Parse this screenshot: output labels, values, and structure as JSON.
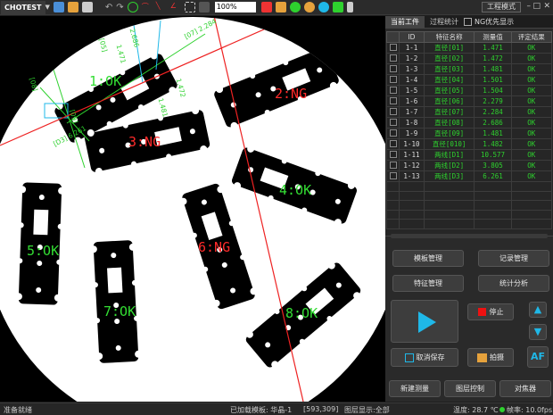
{
  "app": {
    "title": "CHOTEST",
    "mode_button": "工程模式",
    "zoom": "100%"
  },
  "tabs": {
    "current": "当前工件",
    "stats": "过程统计",
    "ng_first": "NG优先显示"
  },
  "table": {
    "headers": [
      "",
      "ID",
      "特征名称",
      "测量值",
      "评定结果"
    ],
    "rows": [
      {
        "id": "1-1",
        "name": "直径[01]",
        "value": "1.471",
        "result": "OK"
      },
      {
        "id": "1-2",
        "name": "直径[02]",
        "value": "1.472",
        "result": "OK"
      },
      {
        "id": "1-3",
        "name": "直径[03]",
        "value": "1.481",
        "result": "OK"
      },
      {
        "id": "1-4",
        "name": "直径[04]",
        "value": "1.501",
        "result": "OK"
      },
      {
        "id": "1-5",
        "name": "直径[05]",
        "value": "1.504",
        "result": "OK"
      },
      {
        "id": "1-6",
        "name": "直径[06]",
        "value": "2.279",
        "result": "OK"
      },
      {
        "id": "1-7",
        "name": "直径[07]",
        "value": "2.284",
        "result": "OK"
      },
      {
        "id": "1-8",
        "name": "直径[08]",
        "value": "2.686",
        "result": "OK"
      },
      {
        "id": "1-9",
        "name": "直径[09]",
        "value": "1.481",
        "result": "OK"
      },
      {
        "id": "1-10",
        "name": "直径[010]",
        "value": "1.482",
        "result": "OK"
      },
      {
        "id": "1-11",
        "name": "两线[D1]",
        "value": "10.577",
        "result": "OK"
      },
      {
        "id": "1-12",
        "name": "两线[D2]",
        "value": "3.805",
        "result": "OK"
      },
      {
        "id": "1-13",
        "name": "两线[D3]",
        "value": "6.261",
        "result": "OK"
      }
    ]
  },
  "buttons": {
    "template": "模板管理",
    "record": "记录管理",
    "feature": "特征管理",
    "stats_analysis": "统计分析",
    "stop": "停止",
    "cancel_save": "取消保存",
    "capture": "拍摄",
    "af": "AF",
    "new_measure": "新建测量",
    "layer": "图层控制",
    "focus": "对焦器"
  },
  "parts": [
    {
      "label": "1:OK"
    },
    {
      "label": "2:NG"
    },
    {
      "label": "3:NG"
    },
    {
      "label": "4:OK"
    },
    {
      "label": "5:OK"
    },
    {
      "label": "6:NG"
    },
    {
      "label": "7:OK"
    },
    {
      "label": "8:OK"
    }
  ],
  "annotations": {
    "dims": [
      "[07] 2.284",
      "[D3] 6.261",
      "1.471",
      "1.472",
      "1.481",
      "2.686",
      "[05]",
      "[08]",
      "[09]"
    ]
  },
  "status": {
    "ready": "准备就绪",
    "template": "已加载模板: 华晶-1",
    "coords": "[593,309]",
    "layer": "图层显示:全部",
    "temp": "温度: 28.7 ℃",
    "fps": "帧率: 10.0fps"
  },
  "colors": {
    "ok": "#33dd33",
    "ng": "#ff2a2a",
    "accent": "#1fb8e8",
    "stop": "#ee1111"
  }
}
